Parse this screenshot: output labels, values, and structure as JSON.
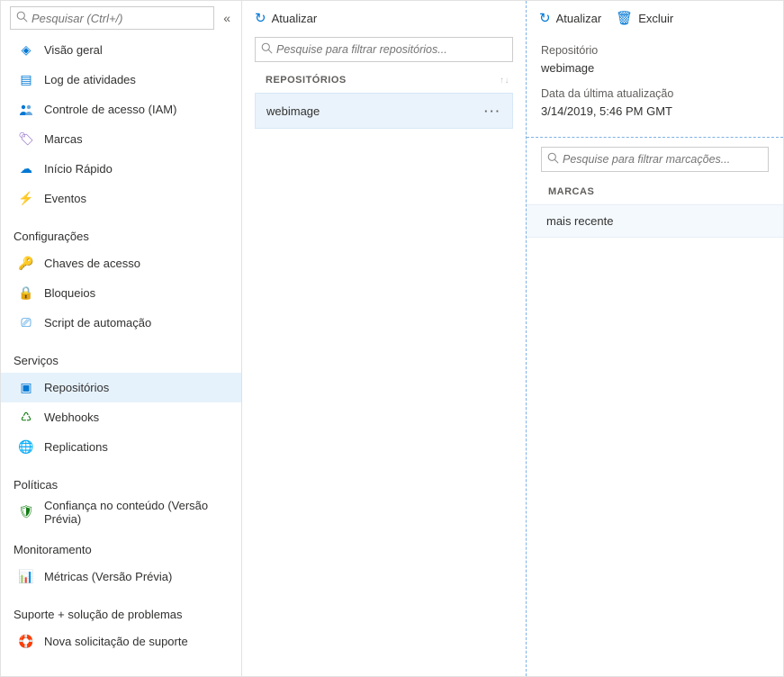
{
  "sidebar": {
    "search_placeholder": "Pesquisar (Ctrl+/)",
    "nav": [
      {
        "label": "Visão geral",
        "icon": "overview-icon"
      },
      {
        "label": "Log de atividades",
        "icon": "activity-log-icon"
      },
      {
        "label": "Controle de acesso (IAM)",
        "icon": "access-control-icon"
      },
      {
        "label": "Marcas",
        "icon": "tags-icon"
      },
      {
        "label": "Início Rápido",
        "icon": "quickstart-icon"
      },
      {
        "label": "Eventos",
        "icon": "events-icon"
      }
    ],
    "sections": [
      {
        "title": "Configurações",
        "items": [
          {
            "label": "Chaves de acesso",
            "icon": "keys-icon"
          },
          {
            "label": "Bloqueios",
            "icon": "lock-icon"
          },
          {
            "label": "Script de automação",
            "icon": "automation-icon"
          }
        ]
      },
      {
        "title": "Serviços",
        "items": [
          {
            "label": "Repositórios",
            "icon": "repositories-icon",
            "selected": true
          },
          {
            "label": "Webhooks",
            "icon": "webhooks-icon"
          },
          {
            "label": "Replications",
            "icon": "replications-icon"
          }
        ]
      },
      {
        "title": "Políticas",
        "items": [
          {
            "label": "Confiança no conteúdo (Versão Prévia)",
            "icon": "content-trust-icon"
          }
        ]
      },
      {
        "title": "Monitoramento",
        "items": [
          {
            "label": "Métricas (Versão Prévia)",
            "icon": "metrics-icon"
          }
        ]
      },
      {
        "title": "Suporte + solução de problemas",
        "items": [
          {
            "label": "Nova solicitação de suporte",
            "icon": "support-icon"
          }
        ]
      }
    ]
  },
  "mid": {
    "toolbar": {
      "refresh": "Atualizar"
    },
    "search_placeholder": "Pesquise para filtrar repositórios...",
    "list_header": "REPOSITÓRIOS",
    "rows": [
      {
        "name": "webimage"
      }
    ]
  },
  "right": {
    "toolbar": {
      "refresh": "Atualizar",
      "delete": "Excluir"
    },
    "meta": {
      "repo_label": "Repositório",
      "repo_value": "webimage",
      "updated_label": "Data da última atualização",
      "updated_value": "3/14/2019, 5:46 PM GMT"
    },
    "search_placeholder": "Pesquise para filtrar marcações...",
    "tags_header": "MARCAS",
    "tags": [
      {
        "name": "mais recente"
      }
    ]
  }
}
